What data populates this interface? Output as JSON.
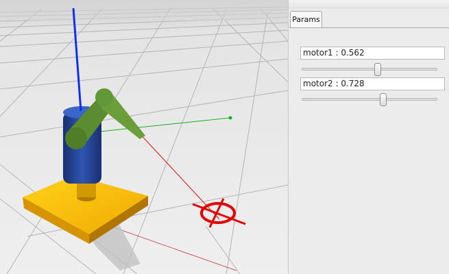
{
  "tab": {
    "label": "Params"
  },
  "params": [
    {
      "name": "motor1",
      "separator": " : ",
      "value": "0.562",
      "slider_fraction": 0.562
    },
    {
      "name": "motor2",
      "separator": " : ",
      "value": "0.728",
      "slider_fraction": 0.604
    }
  ],
  "colors": {
    "viewport_background": "#eaeaea",
    "axis_x": "#e01010",
    "axis_y": "#16b016",
    "axis_z": "#1030e8",
    "robot_base": "#f2b400",
    "robot_column": "#243f8c",
    "robot_arm": "#5a8c30",
    "target_marker": "#e00000"
  },
  "icons": {
    "target": "crosshair-target-icon"
  }
}
